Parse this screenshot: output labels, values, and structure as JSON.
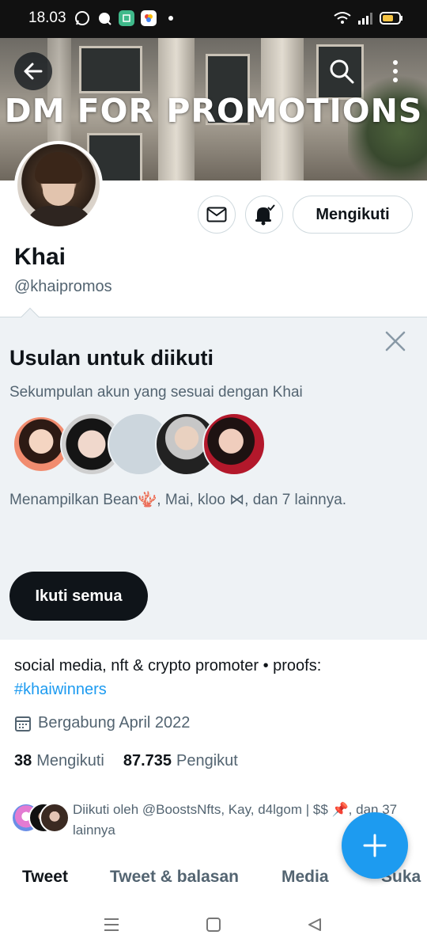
{
  "status_bar": {
    "time": "18.03"
  },
  "header": {
    "banner_text": "DM FOR PROMOTIONS"
  },
  "actions": {
    "follow_label": "Mengikuti"
  },
  "profile": {
    "name": "Khai",
    "handle": "@khaipromos",
    "bio": "social media, nft & crypto promoter • proofs:",
    "bio_hashtag": "#khaiwinners",
    "joined": "Bergabung April 2022",
    "following_count": "38",
    "following_label": "Mengikuti",
    "followers_count": "87.735",
    "followers_label": "Pengikut",
    "followed_by": "Diikuti oleh @BoostsNfts, Kay, d4lgom | $$ 📌, dan 37 lainnya"
  },
  "suggestions": {
    "title": "Usulan untuk diikuti",
    "subtitle": "Sekumpulan akun yang sesuai dengan Khai",
    "names_text": "Menampilkan Bean🪸, Mai, kloo ⋈, dan 7 lainnya.",
    "follow_all_label": "Ikuti semua"
  },
  "tabs": [
    {
      "label": "Tweet"
    },
    {
      "label": "Tweet & balasan"
    },
    {
      "label": "Media"
    },
    {
      "label": "Suka"
    }
  ],
  "colors": {
    "accent": "#1d9bf0",
    "text": "#0f1419",
    "muted": "#536471",
    "panel": "#eef2f5"
  },
  "icons": [
    "back-arrow-icon",
    "search-icon",
    "more-vertical-icon",
    "mail-icon",
    "bell-icon",
    "close-icon",
    "calendar-icon",
    "plus-icon"
  ]
}
